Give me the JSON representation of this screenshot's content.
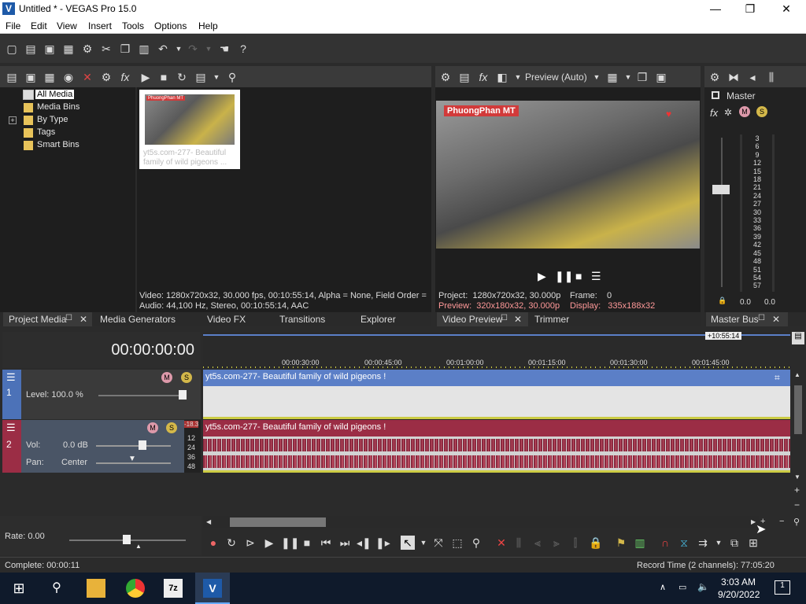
{
  "window": {
    "title": "Untitled * - VEGAS Pro 15.0",
    "logo_letter": "V",
    "minimize": "—",
    "maximize": "❐",
    "close": "✕"
  },
  "menu": [
    "File",
    "Edit",
    "View",
    "Insert",
    "Tools",
    "Options",
    "Help"
  ],
  "project_media": {
    "tree": [
      "All Media",
      "Media Bins",
      "By Type",
      "Tags",
      "Smart Bins"
    ],
    "expand_glyph": "+",
    "thumb_label": "yt5s.com-277- Beautiful family of wild pigeons !",
    "thumb_label_line1": "yt5s.com-277- Beautiful",
    "thumb_label_line2": "family of wild pigeons ...",
    "thumb_watermark": "PhuongPhan MT",
    "info_video": "Video: 1280x720x32, 30.000 fps, 00:10:55:14, Alpha = None, Field Order =",
    "info_audio": "Audio: 44,100 Hz, Stereo, 00:10:55:14, AAC",
    "tabs": [
      "Project Media",
      "Media Generators",
      "Video FX",
      "Transitions",
      "Explorer"
    ]
  },
  "preview": {
    "mode": "Preview (Auto)",
    "watermark": "PhuongPhan MT",
    "project": "Project:  1280x720x32, 30.000p",
    "preview": "Preview:  320x180x32, 30.000p",
    "frame": "Frame:    0",
    "display": "Display:   335x188x32",
    "tabs": [
      "Video Preview",
      "Trimmer"
    ]
  },
  "master": {
    "label": "Master",
    "scale": [
      "3",
      "6",
      "9",
      "12",
      "15",
      "18",
      "21",
      "24",
      "27",
      "30",
      "33",
      "36",
      "39",
      "42",
      "45",
      "48",
      "51",
      "54",
      "57"
    ],
    "left_value": "0.0",
    "right_value": "0.0",
    "tab": "Master Bus"
  },
  "timeline": {
    "time": "00:00:00:00",
    "end_marker": "+10:55:14",
    "ruler": [
      "00:00:30:00",
      "00:00:45:00",
      "00:01:00:00",
      "00:01:15:00",
      "00:01:30:00",
      "00:01:45:00"
    ],
    "video_track": {
      "number": "1",
      "level": "Level: 100.0 %",
      "clip_title": "yt5s.com-277- Beautiful family of wild pigeons !"
    },
    "audio_track": {
      "number": "2",
      "vol_label": "Vol:",
      "vol_value": "0.0 dB",
      "pan_label": "Pan:",
      "pan_value": "Center",
      "meter_top": "-18.3",
      "meter_ticks": [
        "12",
        "24",
        "36",
        "48"
      ],
      "clip_title": "yt5s.com-277- Beautiful family of wild pigeons !"
    },
    "rate": "Rate: 0.00"
  },
  "status": {
    "complete": "Complete: 00:00:11",
    "record_time": "Record Time (2 channels): 77:05:20"
  },
  "taskbar": {
    "time": "3:03 AM",
    "date": "9/20/2022",
    "notification_count": "1",
    "7z": "7z",
    "vegas": "V"
  },
  "colors": {
    "video_track": "#4c72b8",
    "audio_track": "#9b2d45",
    "accent_timeline": "#5b7fc7"
  }
}
